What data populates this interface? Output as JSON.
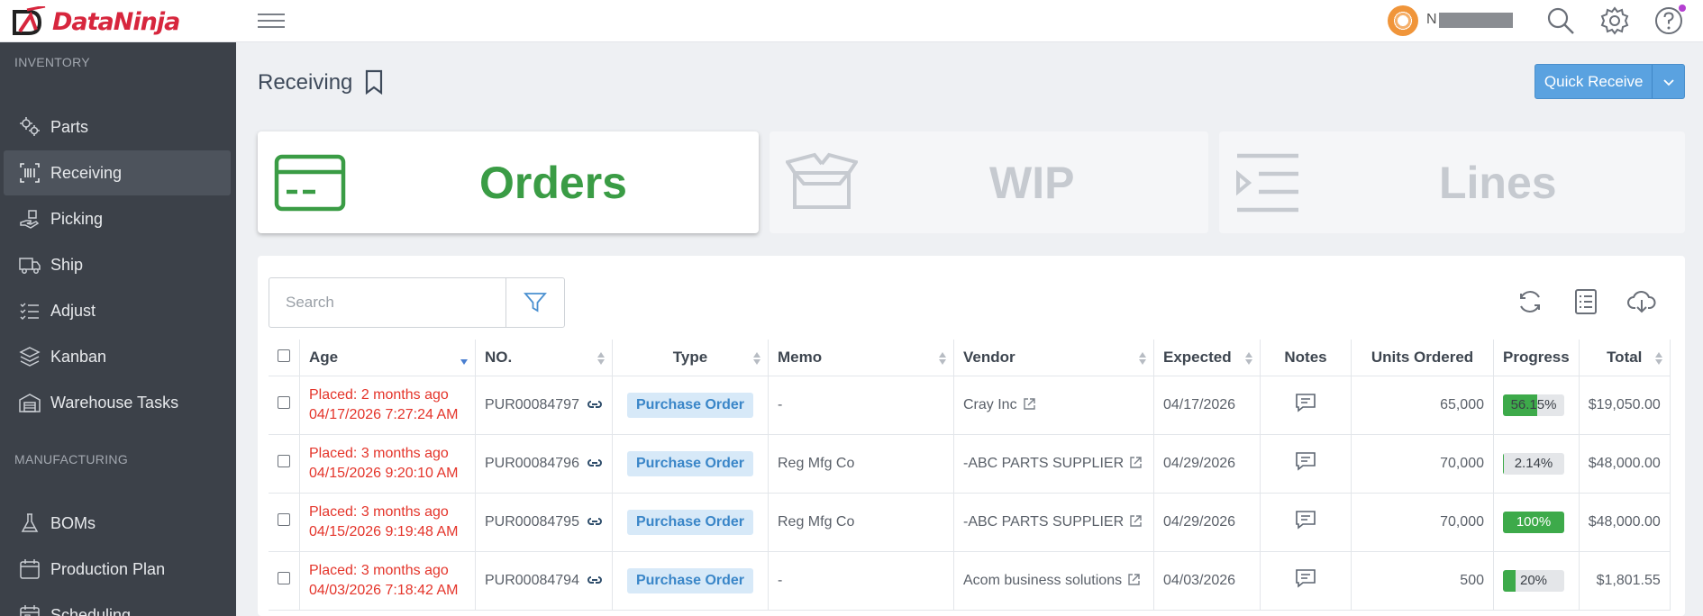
{
  "app": {
    "name": "DataNinja",
    "user_initial": "N"
  },
  "sidebar": {
    "sections": [
      "INVENTORY",
      "MANUFACTURING"
    ],
    "inventory_items": [
      {
        "label": "Parts",
        "icon": "gears-icon"
      },
      {
        "label": "Receiving",
        "icon": "barcode-icon"
      },
      {
        "label": "Picking",
        "icon": "hand-icon"
      },
      {
        "label": "Ship",
        "icon": "truck-icon"
      },
      {
        "label": "Adjust",
        "icon": "checklist-icon"
      },
      {
        "label": "Kanban",
        "icon": "layers-icon"
      },
      {
        "label": "Warehouse Tasks",
        "icon": "warehouse-icon"
      }
    ],
    "manufacturing_items": [
      {
        "label": "BOMs",
        "icon": "flask-icon"
      },
      {
        "label": "Production Plan",
        "icon": "calendar-icon"
      },
      {
        "label": "Scheduling",
        "icon": "calendar-grid-icon"
      }
    ]
  },
  "header": {
    "title": "Receiving",
    "quick_receive": "Quick Receive"
  },
  "tabs": [
    {
      "label": "Orders",
      "active": true,
      "color": "#3a9c45"
    },
    {
      "label": "WIP",
      "active": false,
      "color": "#c6cad0"
    },
    {
      "label": "Lines",
      "active": false,
      "color": "#c6cad0"
    }
  ],
  "search": {
    "placeholder": "Search"
  },
  "table": {
    "columns": [
      "Age",
      "NO.",
      "Type",
      "Memo",
      "Vendor",
      "Expected",
      "Notes",
      "Units Ordered",
      "Progress",
      "Total"
    ],
    "rows": [
      {
        "age_line1": "Placed: 2 months ago",
        "age_line2": "04/17/2026 7:27:24 AM",
        "no": "PUR00084797",
        "type": "Purchase Order",
        "memo": "-",
        "vendor": "Cray Inc",
        "expected": "04/17/2026",
        "units": "65,000",
        "progress_label": "56.15%",
        "progress": 0.5615,
        "total": "$19,050.00"
      },
      {
        "age_line1": "Placed: 3 months ago",
        "age_line2": "04/15/2026 9:20:10 AM",
        "no": "PUR00084796",
        "type": "Purchase Order",
        "memo": "Reg Mfg Co",
        "vendor": "-ABC PARTS SUPPLIER",
        "expected": "04/29/2026",
        "units": "70,000",
        "progress_label": "2.14%",
        "progress": 0.0214,
        "total": "$48,000.00"
      },
      {
        "age_line1": "Placed: 3 months ago",
        "age_line2": "04/15/2026 9:19:48 AM",
        "no": "PUR00084795",
        "type": "Purchase Order",
        "memo": "Reg Mfg Co",
        "vendor": "-ABC PARTS SUPPLIER",
        "expected": "04/29/2026",
        "units": "70,000",
        "progress_label": "100%",
        "progress": 1.0,
        "total": "$48,000.00"
      },
      {
        "age_line1": "Placed: 3 months ago",
        "age_line2": "04/03/2026 7:18:42 AM",
        "no": "PUR00084794",
        "type": "Purchase Order",
        "memo": "-",
        "vendor": "Acom business solutions",
        "expected": "04/03/2026",
        "units": "500",
        "progress_label": "20%",
        "progress": 0.2,
        "total": "$1,801.55"
      }
    ]
  },
  "colors": {
    "accent": "#5aa2e0",
    "sidebar": "#3c4149",
    "success": "#3daa4a",
    "danger": "#e4342a",
    "brand": "#d7263d"
  }
}
